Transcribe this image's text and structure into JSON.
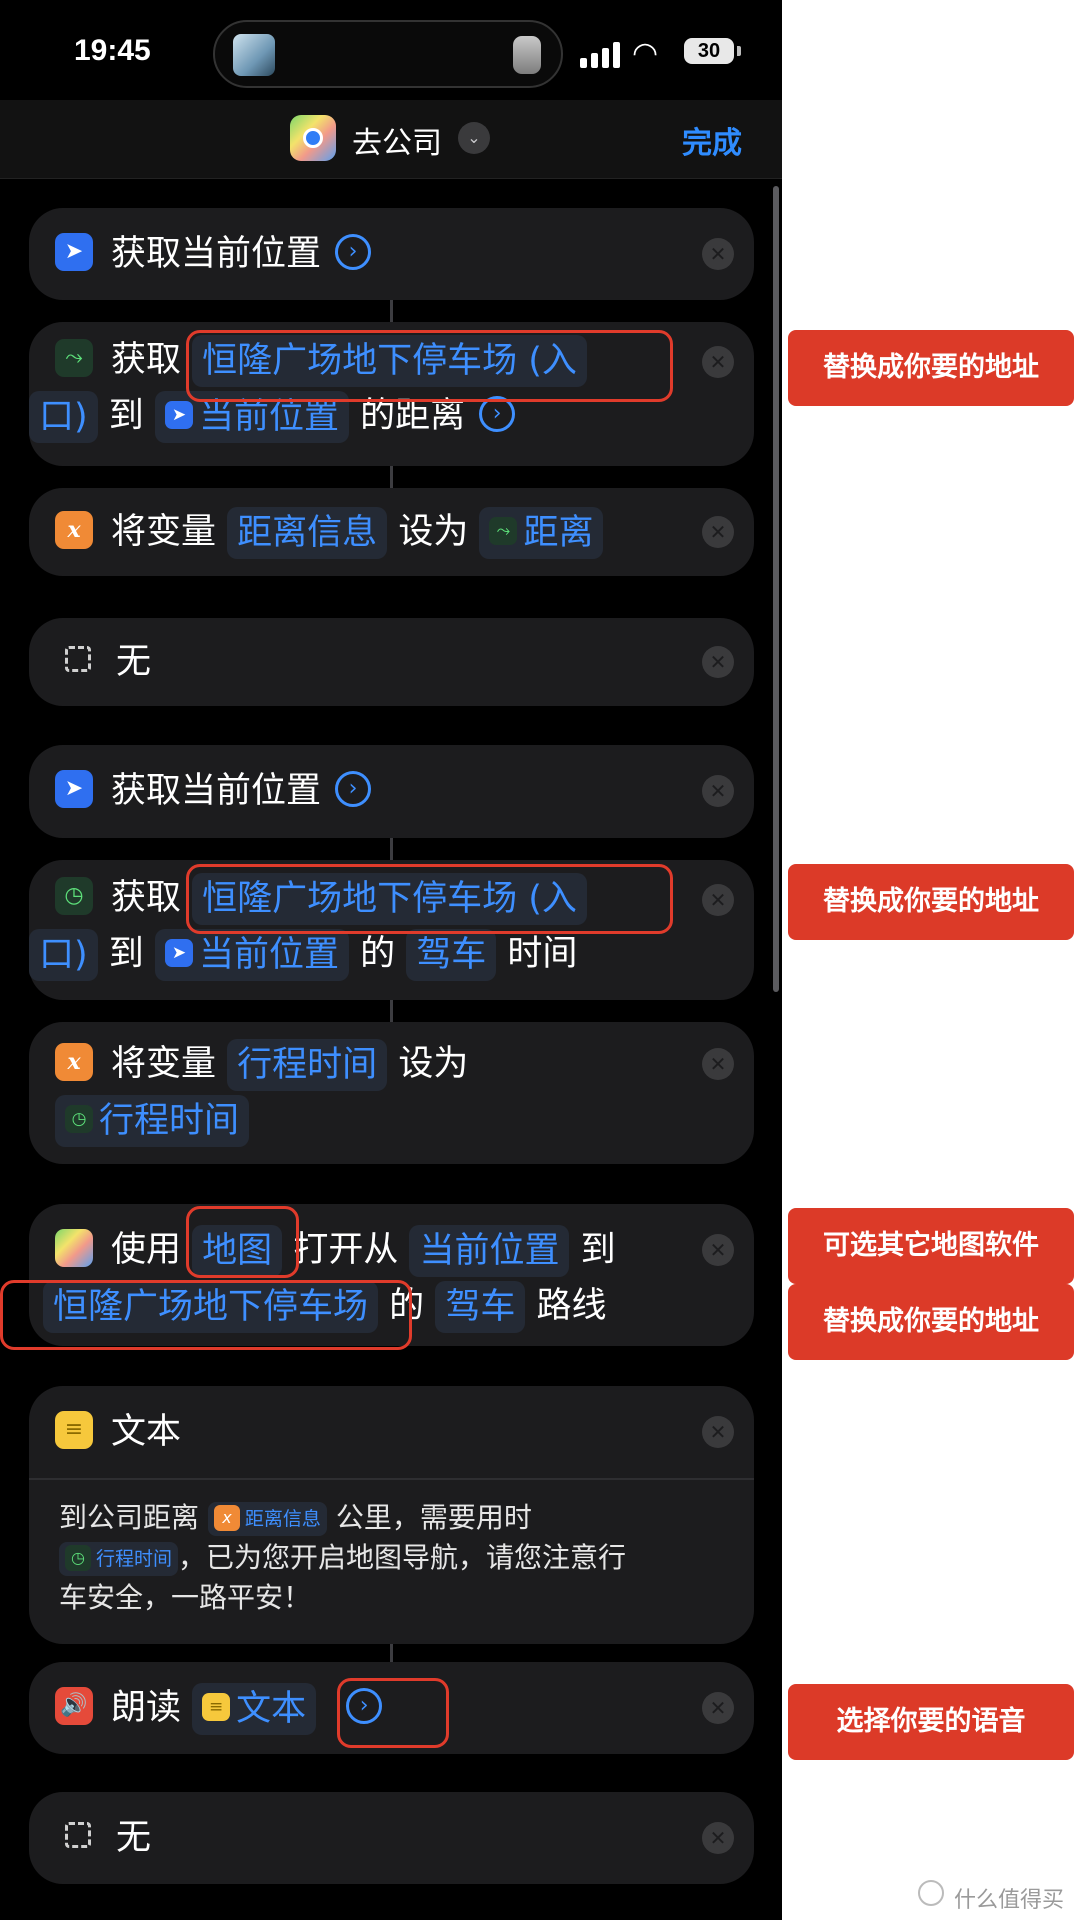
{
  "status_bar": {
    "time": "19:45",
    "battery": "30"
  },
  "nav": {
    "title": "去公司",
    "done": "完成"
  },
  "cards": {
    "get_location_1": {
      "label": "获取当前位置"
    },
    "distance": {
      "get": "获取",
      "destination_part1": "恒隆广场地下停车场 (入",
      "destination_part2": "口)",
      "to": "到",
      "origin": "当前位置",
      "suffix": "的距离"
    },
    "set_var_1": {
      "prefix": "将变量",
      "var_name": "距离信息",
      "set_as": "设为",
      "value": "距离"
    },
    "nothing_1": {
      "label": "无"
    },
    "get_location_2": {
      "label": "获取当前位置"
    },
    "travel_time": {
      "get": "获取",
      "destination_part1": "恒隆广场地下停车场 (入",
      "destination_part2": "口)",
      "to": "到",
      "origin": "当前位置",
      "of": "的",
      "mode": "驾车",
      "suffix": "时间"
    },
    "set_var_2": {
      "prefix": "将变量",
      "var_name": "行程时间",
      "set_as": "设为",
      "value": "行程时间"
    },
    "open_maps": {
      "use": "使用",
      "app": "地图",
      "open_from": "打开从",
      "origin": "当前位置",
      "to": "到",
      "destination": "恒隆广场地下停车场",
      "of": "的",
      "mode": "驾车",
      "route": "路线"
    },
    "text": {
      "label": "文本",
      "line1_prefix": "到公司距离",
      "var_distance": "距离信息",
      "line1_suffix": "公里，需要用时",
      "var_time": "行程时间",
      "line2_suffix": "，已为您开启地图导航，请您注意行",
      "line3": "车安全，一路平安！"
    },
    "speak": {
      "label": "朗读",
      "token": "文本"
    },
    "nothing_2": {
      "label": "无"
    }
  },
  "annotations": {
    "replace_address": "替换成你要的地址",
    "other_map_app": "可选其它地图软件",
    "choose_voice": "选择你要的语音"
  },
  "watermark": "什么值得买",
  "icons": [
    "location-arrow-icon",
    "route-icon",
    "variable-icon",
    "dashed-square-icon",
    "clock-icon",
    "maps-icon",
    "text-icon",
    "speaker-icon",
    "close-icon",
    "arrow-circle-icon",
    "chevron-down-icon"
  ],
  "colors": {
    "accent": "#3e8fff",
    "annotation": "#dc3a28",
    "card": "#1c1c1e"
  }
}
